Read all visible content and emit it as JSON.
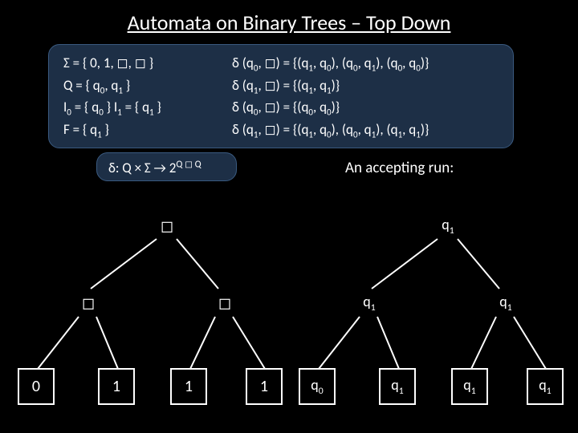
{
  "title": "Automata on Binary Trees – Top Down",
  "defs": {
    "sigma": "Σ = { 0, 1, □, □ }",
    "Q": "Q = { q₀, q₁ }",
    "I": "I₀ = { q₀ }   I₁ = { q₁ }",
    "F": "F = { q₁ }",
    "d1": "δ (q₀, □) = {(q₁, q₀), (q₀, q₁), (q₀, q₀)}",
    "d2": "δ (q₁, □) = {(q₁, q₁)}",
    "d3": "δ (q₀, □) = {(q₀, q₀)}",
    "d4": "δ (q₁, □) = {(q₁, q₀), (q₀, q₁), (q₁, q₁)}"
  },
  "deltatype": "δ: Q × Σ → 2^(Q×Q)",
  "acclabel": "An accepting run:",
  "left_tree": {
    "root": "□",
    "l": "□",
    "r": "□",
    "ll": "0",
    "lr": "1",
    "rl": "1",
    "rr": "1"
  },
  "right_tree": {
    "root": "q₁",
    "l": "q₁",
    "r": "q₁",
    "ll": "q₀",
    "lr": "q₁",
    "rl": "q₁",
    "rr": "q₁"
  }
}
